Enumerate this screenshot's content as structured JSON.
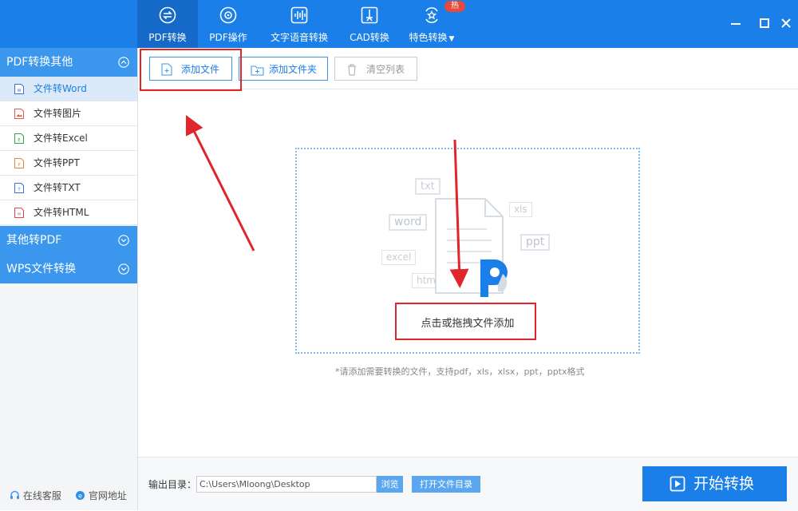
{
  "nav": {
    "tabs": [
      {
        "label": "PDF转换",
        "icon": "pdf-convert-icon",
        "active": true
      },
      {
        "label": "PDF操作",
        "icon": "pdf-operate-icon",
        "active": false
      },
      {
        "label": "文字语音转换",
        "icon": "voice-wave-icon",
        "active": false
      },
      {
        "label": "CAD转换",
        "icon": "cad-icon",
        "active": false
      },
      {
        "label": "特色转换",
        "icon": "star-convert-icon",
        "active": false
      }
    ],
    "hot_badge": "热",
    "window_controls": [
      "minimize-icon",
      "maximize-icon",
      "close-icon"
    ]
  },
  "sidebar": {
    "sections": [
      {
        "label": "PDF转换其他",
        "expanded": true
      },
      {
        "label": "其他转PDF",
        "expanded": false
      },
      {
        "label": "WPS文件转换",
        "expanded": false
      }
    ],
    "items": [
      {
        "label": "文件转Word",
        "icon": "word-file-icon",
        "color": "#3d6fd8",
        "selected": true
      },
      {
        "label": "文件转图片",
        "icon": "image-file-icon",
        "color": "#e05a4f"
      },
      {
        "label": "文件转Excel",
        "icon": "excel-file-icon",
        "color": "#2ea44f"
      },
      {
        "label": "文件转PPT",
        "icon": "ppt-file-icon",
        "color": "#e0883a"
      },
      {
        "label": "文件转TXT",
        "icon": "txt-file-icon",
        "color": "#3d6fd8"
      },
      {
        "label": "文件转HTML",
        "icon": "html-file-icon",
        "color": "#d94a4a"
      }
    ],
    "footer": {
      "service": "在线客服",
      "website": "官网地址"
    }
  },
  "toolbar": {
    "add_file": "添加文件",
    "add_folder": "添加文件夹",
    "clear_list": "清空列表"
  },
  "dropzone": {
    "tags": [
      "txt",
      "xls",
      "word",
      "ppt",
      "excel",
      "html"
    ],
    "label": "点击或拖拽文件添加",
    "hint": "*请添加需要转换的文件，支持pdf，xls，xlsx，ppt，pptx格式"
  },
  "output": {
    "label": "输出目录：",
    "path": "C:\\Users\\Mloong\\Desktop",
    "browse": "浏览",
    "open_dir": "打开文件目录",
    "start": "开始转换"
  },
  "colors": {
    "brand": "#1a7fe8",
    "annotation": "#e0252b"
  }
}
